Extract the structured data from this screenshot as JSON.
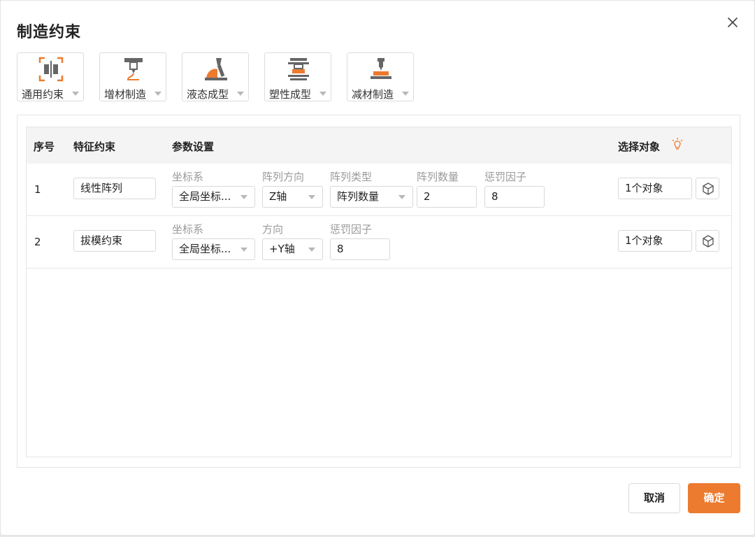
{
  "dialog": {
    "title": "制造约束"
  },
  "tools": [
    {
      "label": "通用约束",
      "icon": "general-constraint-icon"
    },
    {
      "label": "增材制造",
      "icon": "additive-manufacturing-icon"
    },
    {
      "label": "液态成型",
      "icon": "liquid-forming-icon"
    },
    {
      "label": "塑性成型",
      "icon": "plastic-forming-icon"
    },
    {
      "label": "减材制造",
      "icon": "subtractive-manufacturing-icon"
    }
  ],
  "table": {
    "headers": {
      "index": "序号",
      "feature": "特征约束",
      "params": "参数设置",
      "target": "选择对象"
    },
    "rows": [
      {
        "index": "1",
        "feature": "线性阵列",
        "params": [
          {
            "label": "坐标系",
            "value": "全局坐标...",
            "type": "select"
          },
          {
            "label": "阵列方向",
            "value": "Z轴",
            "type": "select"
          },
          {
            "label": "阵列类型",
            "value": "阵列数量",
            "type": "select"
          },
          {
            "label": "阵列数量",
            "value": "2",
            "type": "input"
          },
          {
            "label": "惩罚因子",
            "value": "8",
            "type": "input"
          }
        ],
        "target": "1个对象"
      },
      {
        "index": "2",
        "feature": "拔模约束",
        "params": [
          {
            "label": "坐标系",
            "value": "全局坐标...",
            "type": "select"
          },
          {
            "label": "方向",
            "value": "+Y轴",
            "type": "select"
          },
          {
            "label": "惩罚因子",
            "value": "8",
            "type": "input"
          }
        ],
        "target": "1个对象"
      }
    ]
  },
  "footer": {
    "cancel_label": "取消",
    "ok_label": "确定"
  },
  "colors": {
    "accent": "#ec7a2f",
    "icon_gray": "#7a7a7a"
  }
}
